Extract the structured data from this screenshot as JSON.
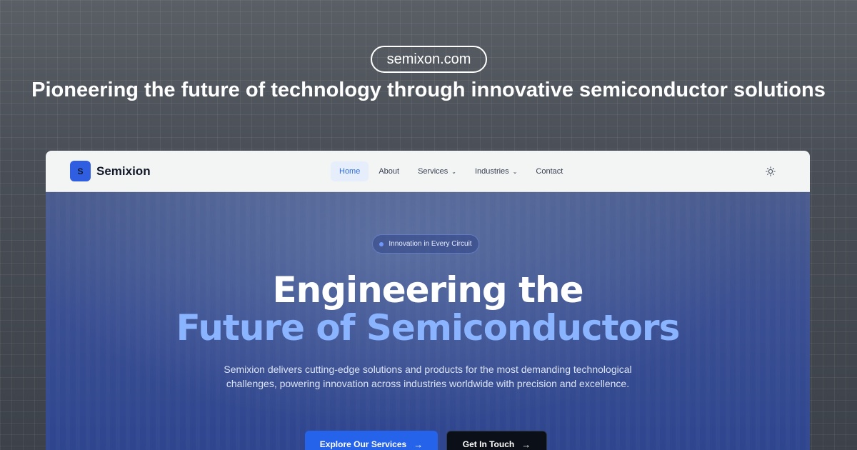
{
  "header": {
    "domain": "semixon.com",
    "tagline": "Pioneering the future of technology through innovative semiconductor solutions"
  },
  "navbar": {
    "logo_letter": "S",
    "brand": "Semixion",
    "links": [
      {
        "label": "Home",
        "active": true
      },
      {
        "label": "About"
      },
      {
        "label": "Services",
        "dropdown": true
      },
      {
        "label": "Industries",
        "dropdown": true
      },
      {
        "label": "Contact"
      }
    ],
    "theme_toggle_icon": "sun-icon"
  },
  "hero": {
    "badge": "Innovation in Every Circuit",
    "headline_line1": "Engineering the",
    "headline_line2": "Future of Semiconductors",
    "description": "Semixion delivers cutting-edge solutions and products for the most demanding technological challenges, powering innovation across industries worldwide with precision and excellence.",
    "primary_button": "Explore Our Services",
    "secondary_button": "Get In Touch"
  },
  "colors": {
    "accent": "#2563eb",
    "headline_accent": "#8ab4ff",
    "dark_button": "#0b0f17"
  }
}
